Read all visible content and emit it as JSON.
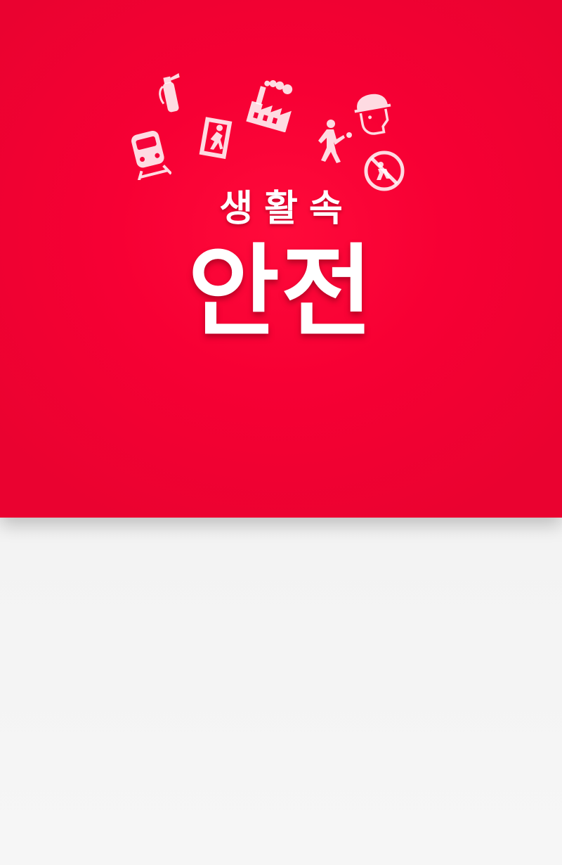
{
  "hero": {
    "subtitle": "생활속",
    "title": "안전",
    "background_color": "#f70034",
    "icons": [
      "train-icon",
      "fire-extinguisher-icon",
      "emergency-exit-icon",
      "factory-icon",
      "pedestrian-icon",
      "hard-hat-worker-icon",
      "no-entry-icon"
    ]
  },
  "lower_area": {
    "background_color": "#f2f2f2"
  }
}
